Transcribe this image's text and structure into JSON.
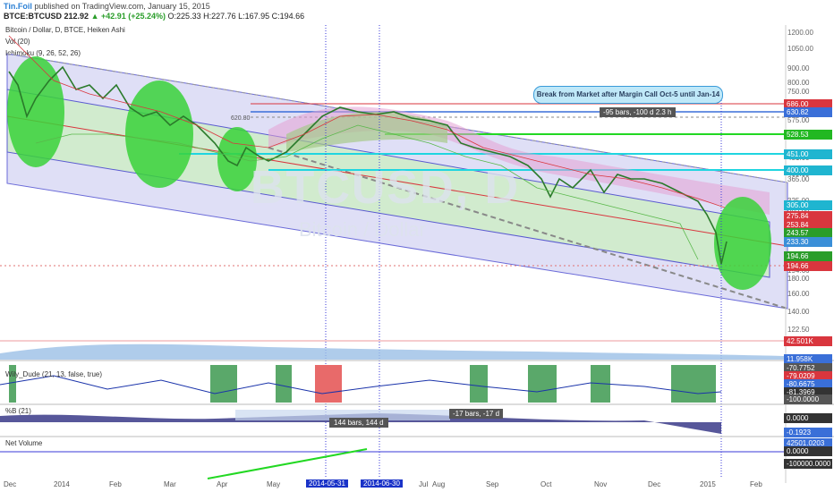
{
  "header": {
    "author": "Tin.Foil",
    "published": " published on TradingView.com, January 15, 2015",
    "symbol": "BTCE:BTCUSD",
    "last": "212.92",
    "change": "▲ +42.91 (+25.24%)",
    "ohlc": "O:225.33 H:227.76 L:167.95 C:194.66"
  },
  "legends": {
    "main": "Bitcoin / Dollar, D, BTCE, Heiken Ashi",
    "vol": "Vol (20)",
    "ichimoku": "Ichimoku (9, 26, 52, 26)",
    "wily": "Wily_Dude (21, 13, false, true)",
    "bb": "%B (21)",
    "netvol": "Net Volume"
  },
  "watermark": {
    "symbol": "BTCUSD, D",
    "name": "Bitcoin / Dollar"
  },
  "annotations": {
    "callout": "Break from Market after Margin Call Oct-5 until Jan-14",
    "bars_range": "-95 bars, -100 d 2.3 h",
    "bars_left": "144 bars, 144 d",
    "bars_right": "-17 bars, -17 d",
    "price_box": "620.80"
  },
  "price_axis": [
    "1200.00",
    "1050.00",
    "900.00",
    "800.00",
    "750.00",
    "650.00",
    "575.00",
    "500.00",
    "451.00",
    "400.00",
    "365.00",
    "325.00",
    "305.00",
    "275.00",
    "245.00",
    "215.00",
    "194.66",
    "180.00",
    "160.00",
    "140.00",
    "122.50"
  ],
  "price_labels": [
    {
      "text": "686.00",
      "color": "#d9363e"
    },
    {
      "text": "630.82",
      "color": "#3a6fd8"
    },
    {
      "text": "528.53",
      "color": "#22b822"
    },
    {
      "text": "451.00",
      "color": "#1fb5d0"
    },
    {
      "text": "400.00",
      "color": "#1fb5d0"
    },
    {
      "text": "305.00",
      "color": "#1fb5d0"
    },
    {
      "text": "275.84",
      "color": "#d9363e"
    },
    {
      "text": "253.84",
      "color": "#d9363e"
    },
    {
      "text": "243.57",
      "color": "#2a9d2a"
    },
    {
      "text": "233.30",
      "color": "#3a8fd8"
    },
    {
      "text": "194.66",
      "color": "#2a9d2a"
    },
    {
      "text": "194.66",
      "color": "#d9363e"
    }
  ],
  "vol_labels": [
    {
      "text": "42.501K",
      "color": "#d9363e"
    },
    {
      "text": "11.958K",
      "color": "#3a6fd8"
    }
  ],
  "wily_labels": [
    {
      "text": "-70.7752",
      "color": "#555"
    },
    {
      "text": "-79.0209",
      "color": "#d9363e"
    },
    {
      "text": "-80.6675",
      "color": "#3a6fd8"
    },
    {
      "text": "-81.3969",
      "color": "#333"
    },
    {
      "text": "-100.0000",
      "color": "#555"
    }
  ],
  "bb_labels": [
    {
      "text": "0.0000",
      "color": "#333"
    },
    {
      "text": "-0.1923",
      "color": "#3a6fd8"
    }
  ],
  "netvol_labels": [
    {
      "text": "42501.0203",
      "color": "#3a6fd8"
    },
    {
      "text": "0.0000",
      "color": "#333"
    },
    {
      "text": "-100000.0000",
      "color": "#333"
    }
  ],
  "x_axis": [
    {
      "label": "Dec"
    },
    {
      "label": "2014"
    },
    {
      "label": "Feb"
    },
    {
      "label": "Mar"
    },
    {
      "label": "Apr"
    },
    {
      "label": "May"
    },
    {
      "label": "Jul"
    },
    {
      "label": "Aug"
    },
    {
      "label": "Sep"
    },
    {
      "label": "Oct"
    },
    {
      "label": "Nov"
    },
    {
      "label": "Dec"
    },
    {
      "label": "2015"
    },
    {
      "label": "Feb"
    }
  ],
  "x_highlights": [
    "2014-05-31",
    "2014-06-30"
  ],
  "colors": {
    "green_zone": "#5fd35f",
    "channel": "#6a6ad8",
    "price_bar_up": "#2a9d2a",
    "price_bar_down": "#d9363e"
  }
}
